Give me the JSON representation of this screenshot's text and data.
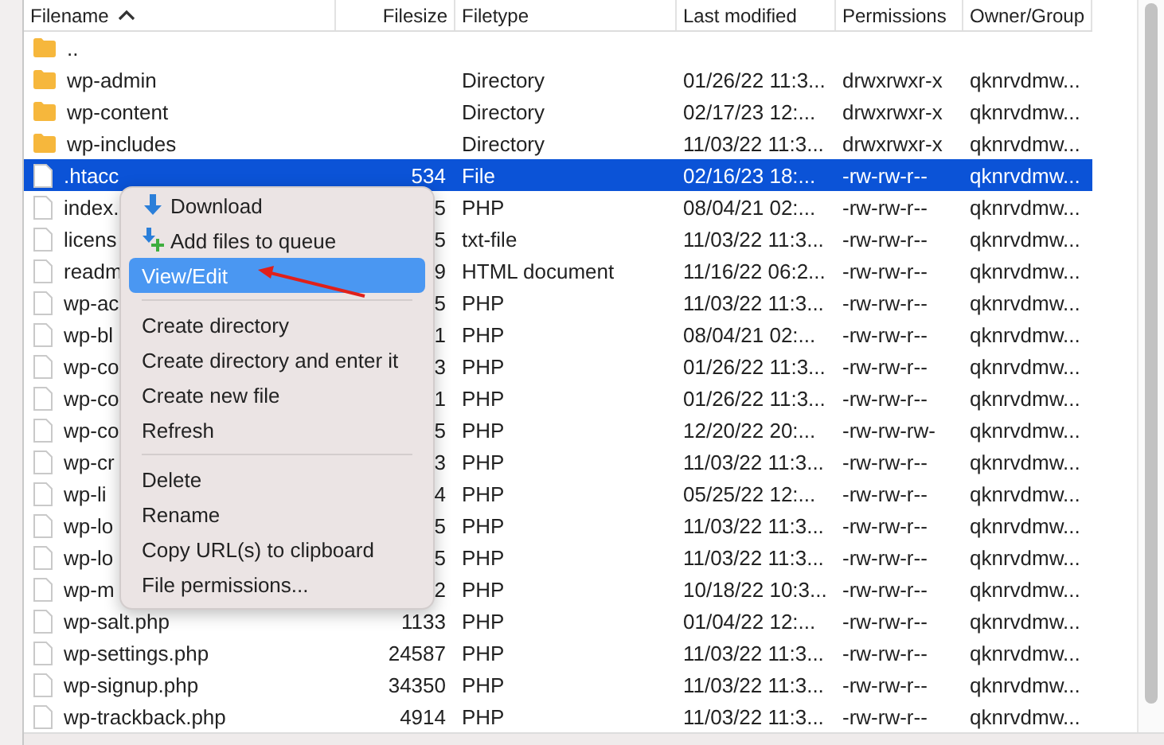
{
  "table": {
    "columns": [
      {
        "label": "Filename",
        "sorted": true
      },
      {
        "label": "Filesize",
        "sorted": false
      },
      {
        "label": "Filetype",
        "sorted": false
      },
      {
        "label": "Last modified",
        "sorted": false
      },
      {
        "label": "Permissions",
        "sorted": false
      },
      {
        "label": "Owner/Group",
        "sorted": false
      }
    ],
    "rows": [
      {
        "kind": "folder",
        "selected": false,
        "name": ".."
      },
      {
        "kind": "folder",
        "selected": false,
        "name": "wp-admin",
        "type": "Directory",
        "modified": "01/26/22 11:3...",
        "permissions": "drwxrwxr-x",
        "owner": "qknrvdmw..."
      },
      {
        "kind": "folder",
        "selected": false,
        "name": "wp-content",
        "type": "Directory",
        "modified": "02/17/23 12:...",
        "permissions": "drwxrwxr-x",
        "owner": "qknrvdmw..."
      },
      {
        "kind": "folder",
        "selected": false,
        "name": "wp-includes",
        "type": "Directory",
        "modified": "11/03/22 11:3...",
        "permissions": "drwxrwxr-x",
        "owner": "qknrvdmw..."
      },
      {
        "kind": "file",
        "selected": true,
        "name": ".htacc",
        "size": "534",
        "type": "File",
        "modified": "02/16/23 18:...",
        "permissions": "-rw-rw-r--",
        "owner": "qknrvdmw..."
      },
      {
        "kind": "file",
        "selected": false,
        "name": "index.",
        "size": "5",
        "type": "PHP",
        "modified": "08/04/21 02:...",
        "permissions": "-rw-rw-r--",
        "owner": "qknrvdmw..."
      },
      {
        "kind": "file",
        "selected": false,
        "name": "licens",
        "size": "5",
        "type": "txt-file",
        "modified": "11/03/22 11:3...",
        "permissions": "-rw-rw-r--",
        "owner": "qknrvdmw..."
      },
      {
        "kind": "file",
        "selected": false,
        "name": "readm",
        "size": "9",
        "type": "HTML document",
        "modified": "11/16/22 06:2...",
        "permissions": "-rw-rw-r--",
        "owner": "qknrvdmw..."
      },
      {
        "kind": "file",
        "selected": false,
        "name": "wp-ac",
        "size": "5",
        "type": "PHP",
        "modified": "11/03/22 11:3...",
        "permissions": "-rw-rw-r--",
        "owner": "qknrvdmw..."
      },
      {
        "kind": "file",
        "selected": false,
        "name": "wp-bl",
        "size": "1",
        "type": "PHP",
        "modified": "08/04/21 02:...",
        "permissions": "-rw-rw-r--",
        "owner": "qknrvdmw..."
      },
      {
        "kind": "file",
        "selected": false,
        "name": "wp-co",
        "size": "3",
        "type": "PHP",
        "modified": "01/26/22 11:3...",
        "permissions": "-rw-rw-r--",
        "owner": "qknrvdmw..."
      },
      {
        "kind": "file",
        "selected": false,
        "name": "wp-co",
        "size": "1",
        "type": "PHP",
        "modified": "01/26/22 11:3...",
        "permissions": "-rw-rw-r--",
        "owner": "qknrvdmw..."
      },
      {
        "kind": "file",
        "selected": false,
        "name": "wp-co",
        "size": "5",
        "type": "PHP",
        "modified": "12/20/22 20:...",
        "permissions": "-rw-rw-rw-",
        "owner": "qknrvdmw..."
      },
      {
        "kind": "file",
        "selected": false,
        "name": "wp-cr",
        "size": "3",
        "type": "PHP",
        "modified": "11/03/22 11:3...",
        "permissions": "-rw-rw-r--",
        "owner": "qknrvdmw..."
      },
      {
        "kind": "file",
        "selected": false,
        "name": "wp-li",
        "size": "4",
        "type": "PHP",
        "modified": "05/25/22 12:...",
        "permissions": "-rw-rw-r--",
        "owner": "qknrvdmw..."
      },
      {
        "kind": "file",
        "selected": false,
        "name": "wp-lo",
        "size": "5",
        "type": "PHP",
        "modified": "11/03/22 11:3...",
        "permissions": "-rw-rw-r--",
        "owner": "qknrvdmw..."
      },
      {
        "kind": "file",
        "selected": false,
        "name": "wp-lo",
        "size": "5",
        "type": "PHP",
        "modified": "11/03/22 11:3...",
        "permissions": "-rw-rw-r--",
        "owner": "qknrvdmw..."
      },
      {
        "kind": "file",
        "selected": false,
        "name": "wp-m",
        "size": "2",
        "type": "PHP",
        "modified": "10/18/22 10:3...",
        "permissions": "-rw-rw-r--",
        "owner": "qknrvdmw..."
      },
      {
        "kind": "file",
        "selected": false,
        "name": "wp-salt.php",
        "size": "1133",
        "type": "PHP",
        "modified": "01/04/22 12:...",
        "permissions": "-rw-rw-r--",
        "owner": "qknrvdmw..."
      },
      {
        "kind": "file",
        "selected": false,
        "name": "wp-settings.php",
        "size": "24587",
        "type": "PHP",
        "modified": "11/03/22 11:3...",
        "permissions": "-rw-rw-r--",
        "owner": "qknrvdmw..."
      },
      {
        "kind": "file",
        "selected": false,
        "name": "wp-signup.php",
        "size": "34350",
        "type": "PHP",
        "modified": "11/03/22 11:3...",
        "permissions": "-rw-rw-r--",
        "owner": "qknrvdmw..."
      },
      {
        "kind": "file",
        "selected": false,
        "name": "wp-trackback.php",
        "size": "4914",
        "type": "PHP",
        "modified": "11/03/22 11:3...",
        "permissions": "-rw-rw-r--",
        "owner": "qknrvdmw..."
      }
    ]
  },
  "context_menu": {
    "items": [
      {
        "kind": "download",
        "label": "Download",
        "selected": false
      },
      {
        "kind": "queue",
        "label": "Add files to queue",
        "selected": false
      },
      {
        "kind": "plain",
        "label": "View/Edit",
        "selected": true
      },
      {
        "kind": "separator"
      },
      {
        "kind": "plain",
        "label": "Create directory",
        "selected": false
      },
      {
        "kind": "plain",
        "label": "Create directory and enter it",
        "selected": false
      },
      {
        "kind": "plain",
        "label": "Create new file",
        "selected": false
      },
      {
        "kind": "plain",
        "label": "Refresh",
        "selected": false
      },
      {
        "kind": "separator"
      },
      {
        "kind": "plain",
        "label": "Delete",
        "selected": false
      },
      {
        "kind": "plain",
        "label": "Rename",
        "selected": false
      },
      {
        "kind": "plain",
        "label": "Copy URL(s) to clipboard",
        "selected": false
      },
      {
        "kind": "plain",
        "label": "File permissions...",
        "selected": false
      }
    ]
  }
}
